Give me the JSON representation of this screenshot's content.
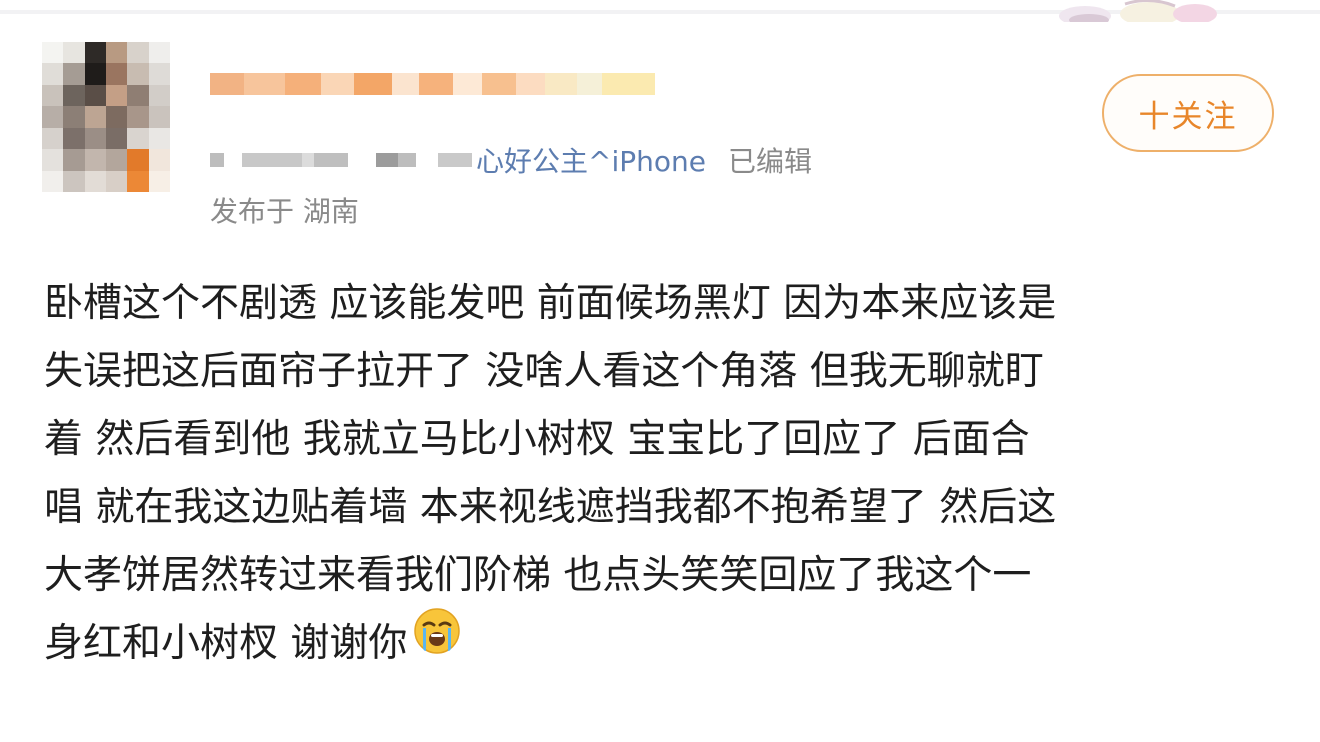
{
  "post": {
    "source": "心好公主^iPhone",
    "edited": "已编辑",
    "location": "发布于 湖南",
    "lines": [
      "卧槽这个不剧透 应该能发吧 前面候场黑灯 因为本来应该是",
      "失误把这后面帘子拉开了 没啥人看这个角落 但我无聊就盯",
      "着 然后看到他 我就立马比小树杈 宝宝比了回应了 后面合",
      "唱 就在我这边贴着墙 本来视线遮挡我都不抱希望了 然后这",
      "大孝饼居然转过来看我们阶梯 也点头笑笑回应了我这个一",
      "身红和小树杈 谢谢你"
    ],
    "emoji": "loudly-crying-face-icon"
  },
  "follow_button": {
    "label": "十关注"
  },
  "colors": {
    "accent": "#e8862a",
    "button_border": "#eeb06a",
    "source_link": "#5d7db0",
    "meta_gray": "#8a8a8a",
    "body_text": "#1e1e1e"
  }
}
